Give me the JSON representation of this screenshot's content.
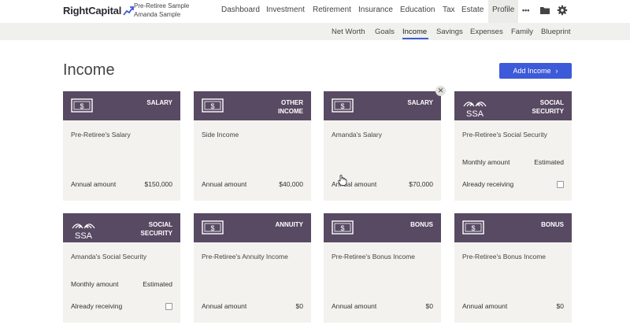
{
  "brand": {
    "name": "RightCapital"
  },
  "client": {
    "line1": "Pre-Retiree Sample",
    "line2": "Amanda Sample"
  },
  "nav": {
    "items": [
      "Dashboard",
      "Investment",
      "Retirement",
      "Insurance",
      "Education",
      "Tax",
      "Estate",
      "Profile"
    ],
    "more": "•••",
    "active": "Profile"
  },
  "subnav": {
    "items": [
      "Net Worth",
      "Goals",
      "Income",
      "Savings",
      "Expenses",
      "Family",
      "Blueprint"
    ],
    "active": "Income"
  },
  "page": {
    "title": "Income",
    "add_button": "Add Income"
  },
  "cards": [
    {
      "type": "SALARY",
      "name": "Pre-Retiree's Salary",
      "icon": "money-icon",
      "annual_label": "Annual amount",
      "annual_value": "$150,000"
    },
    {
      "type_line1": "OTHER",
      "type_line2": "INCOME",
      "name": "Side Income",
      "icon": "money-icon",
      "annual_label": "Annual amount",
      "annual_value": "$40,000"
    },
    {
      "type": "SALARY",
      "name": "Amanda's Salary",
      "icon": "money-icon",
      "annual_label": "Annual amount",
      "annual_value": "$70,000"
    },
    {
      "type_line1": "SOCIAL",
      "type_line2": "SECURITY",
      "name": "Pre-Retiree's Social Security",
      "icon": "ssa-logo",
      "icon_text": "SSA",
      "monthly_label": "Monthly amount",
      "monthly_value": "Estimated",
      "receiving_label": "Already receiving"
    },
    {
      "type_line1": "SOCIAL",
      "type_line2": "SECURITY",
      "name": "Amanda's Social Security",
      "icon": "ssa-logo",
      "icon_text": "SSA",
      "monthly_label": "Monthly amount",
      "monthly_value": "Estimated",
      "receiving_label": "Already receiving"
    },
    {
      "type": "ANNUITY",
      "name": "Pre-Retiree's Annuity Income",
      "icon": "money-icon",
      "annual_label": "Annual amount",
      "annual_value": "$0"
    },
    {
      "type": "BONUS",
      "name": "Pre-Retiree's Bonus Income",
      "icon": "money-icon",
      "annual_label": "Annual amount",
      "annual_value": "$0"
    },
    {
      "type": "BONUS",
      "name": "Pre-Retiree's Bonus Income",
      "icon": "money-icon",
      "annual_label": "Annual amount",
      "annual_value": "$0"
    }
  ],
  "colors": {
    "card_header": "#584a63",
    "card_body": "#f4f2ee",
    "accent": "#3d5ad8"
  }
}
